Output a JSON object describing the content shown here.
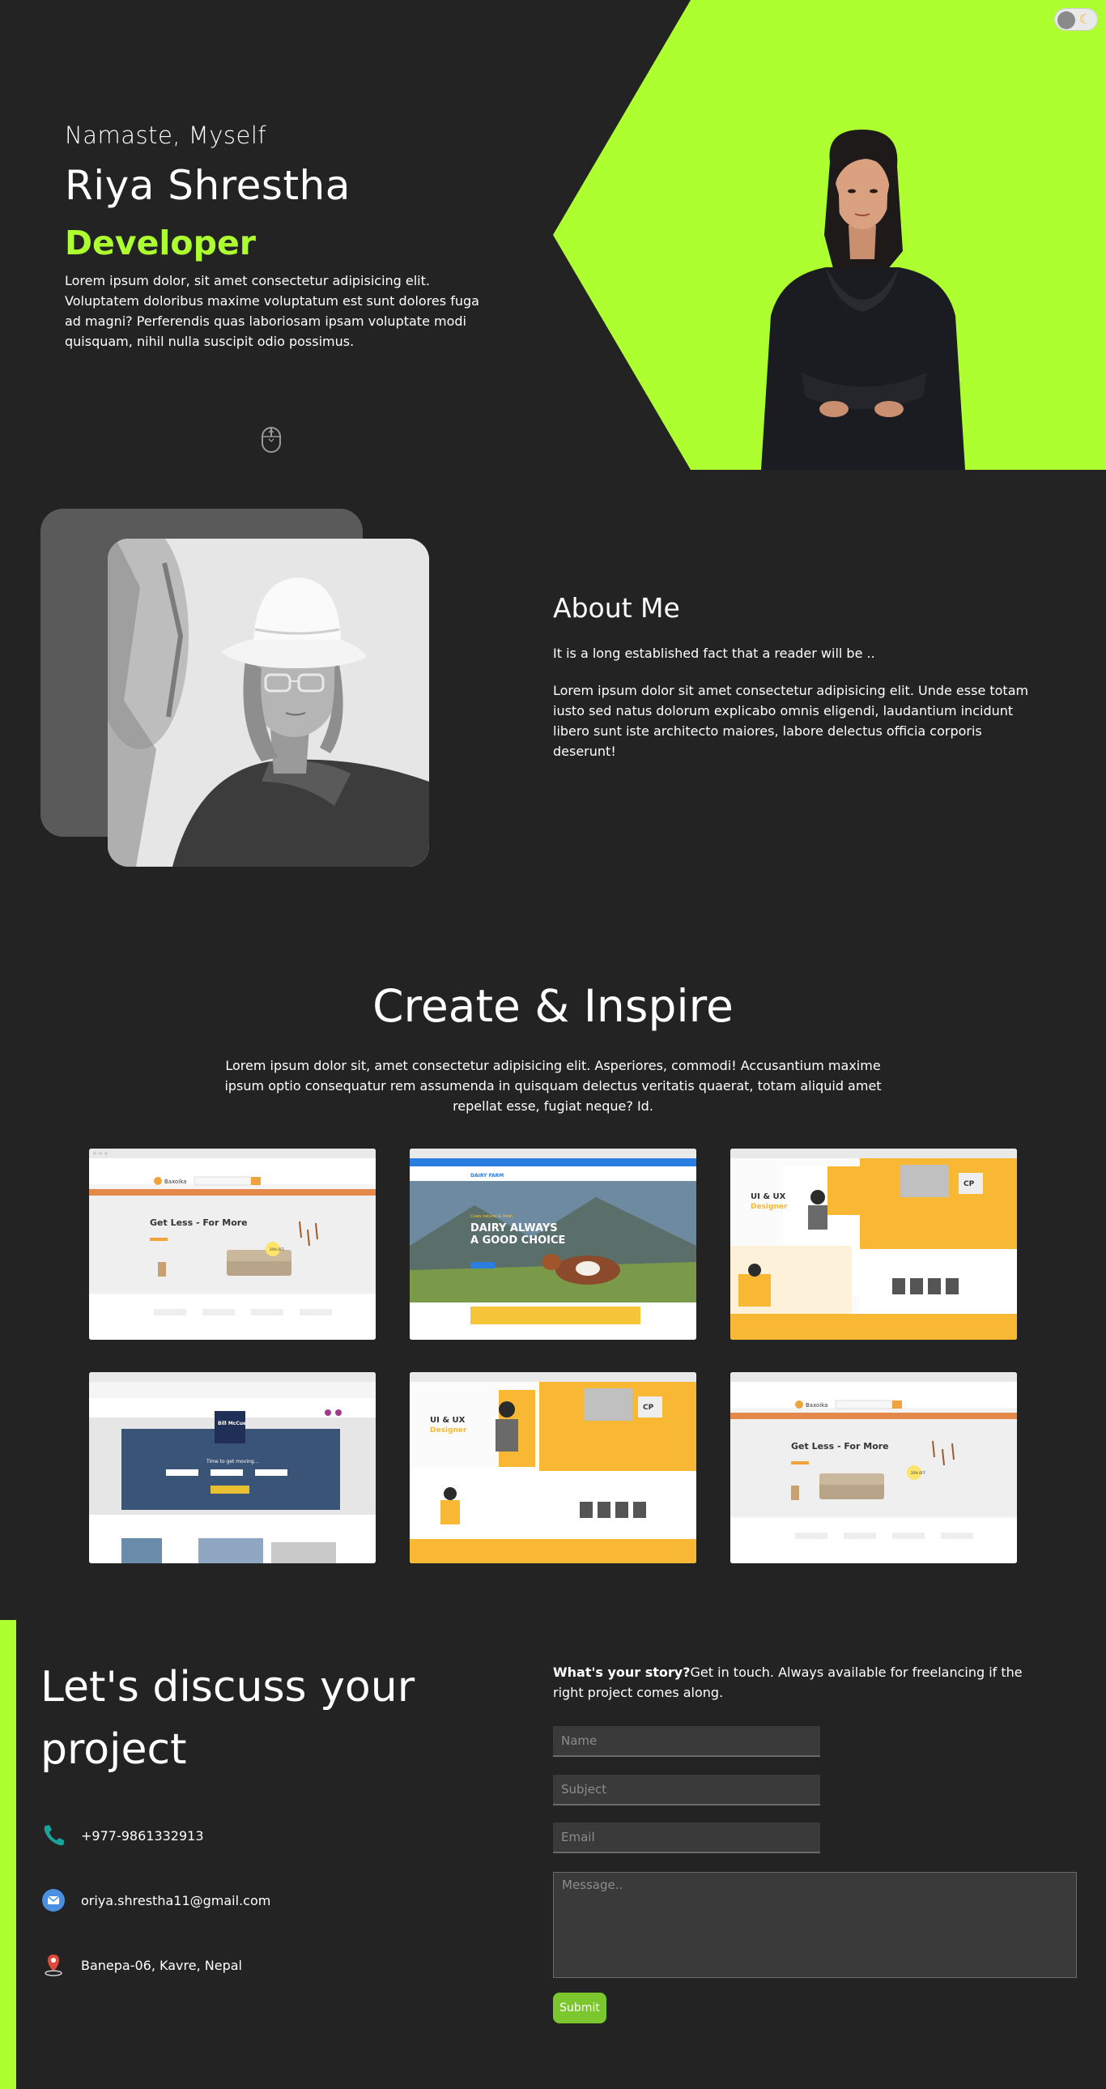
{
  "hero": {
    "greeting": "Namaste, Myself",
    "name": "Riya Shrestha",
    "role": "Developer",
    "description": "Lorem ipsum dolor, sit amet consectetur adipisicing elit. Voluptatem doloribus maxime voluptatum est sunt dolores fuga ad magni? Perferendis quas laboriosam ipsam voluptate modi quisquam, nihil nulla suscipit odio possimus."
  },
  "about": {
    "title": "About Me",
    "lead": "It is a long established fact that a reader will be ..",
    "description": "Lorem ipsum dolor sit amet consectetur adipisicing elit. Unde esse totam iusto sed natus dolorum explicabo omnis eligendi, laudantium incidunt libero sunt iste architecto maiores, labore delectus officia corporis deserunt!"
  },
  "works": {
    "title": "Create & Inspire",
    "description": "Lorem ipsum dolor sit, amet consectetur adipisicing elit. Asperiores, commodi! Accusantium maxime ipsum optio consequatur rem assumenda in quisquam delectus veritatis quaerat, totam aliquid amet repellat esse, fugiat neque? Id.",
    "projects": [
      {
        "type": "furniture",
        "logo": "Baxoika",
        "headline": "Get Less - For More",
        "badge": "20% OFF"
      },
      {
        "type": "dairy",
        "logo": "DAIRY FARM",
        "headline_line1": "DAIRY ALWAYS",
        "headline_line2": "A GOOD CHOICE",
        "kicker": "Cows natural & fresh"
      },
      {
        "type": "designer",
        "headline_line1": "UI & UX",
        "headline_line2": "Designer",
        "badge": "CP"
      },
      {
        "type": "realestate",
        "logo": "Bill McCue",
        "headline": "Time to get moving..."
      },
      {
        "type": "designer",
        "headline_line1": "UI & UX",
        "headline_line2": "Designer",
        "badge": "CP"
      },
      {
        "type": "furniture",
        "logo": "Baxoika",
        "headline": "Get Less - For More",
        "badge": "20% OFF"
      }
    ]
  },
  "contact": {
    "title": "Let's discuss your project",
    "lead_bold": "What's your story?",
    "lead_rest": "Get in touch. Always available for freelancing if the right project comes along.",
    "phone": "+977-9861332913",
    "email": "oriya.shrestha11@gmail.com",
    "address": "Banepa-06, Kavre, Nepal",
    "form": {
      "name_placeholder": "Name",
      "subject_placeholder": "Subject",
      "email_placeholder": "Email",
      "message_placeholder": "Message..",
      "submit_label": "Submit"
    }
  },
  "colors": {
    "accent": "#adff2f",
    "background": "#232323",
    "card": "#5b5a5a",
    "submit": "#7cc62e"
  },
  "icons": {
    "theme": "moon-icon",
    "scroll": "mouse-scroll-icon",
    "phone": "phone-icon",
    "email": "email-icon",
    "address": "location-pin-icon"
  }
}
